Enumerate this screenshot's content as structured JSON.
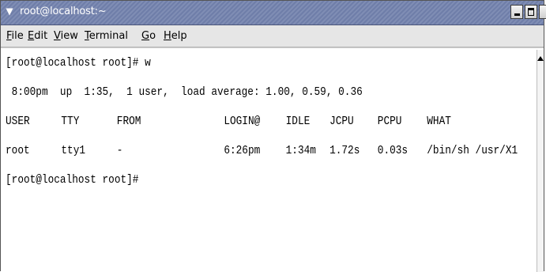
{
  "window": {
    "title": "root@localhost:~",
    "menu_glyph": "▾"
  },
  "menubar": {
    "items": [
      "File",
      "Edit",
      "View",
      "Terminal",
      "Go",
      "Help"
    ]
  },
  "terminal": {
    "prompt1": "[root@localhost root]# w",
    "uptime": " 8:00pm  up  1:35,  1 user,  load average: 1.00, 0.59, 0.36",
    "headers": [
      "USER",
      "TTY",
      "FROM",
      "LOGIN@",
      "IDLE",
      "JCPU",
      "PCPU",
      "WHAT"
    ],
    "row": [
      "root",
      "tty1",
      "-",
      "6:26pm",
      "1:34m",
      "1.72s",
      "0.03s",
      "/bin/sh /usr/X1"
    ],
    "prompt2": "[root@localhost root]#"
  },
  "colors": {
    "titlebar": "#7f8db4",
    "menubar": "#e6e6e6",
    "terminal_bg": "#ffffff",
    "terminal_fg": "#000000"
  },
  "icons": [
    "window-menu-icon",
    "minimize-icon",
    "maximize-icon",
    "close-icon",
    "scroll-up-arrow-icon"
  ]
}
